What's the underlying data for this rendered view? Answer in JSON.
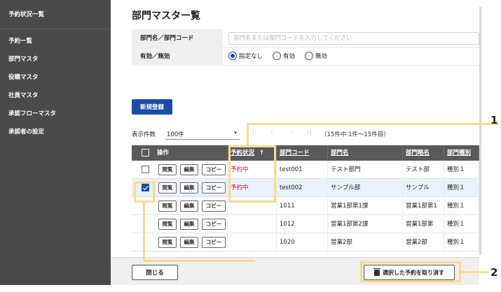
{
  "sidebar": {
    "brand": "予約状況一覧",
    "items": [
      {
        "label": "予約一覧"
      },
      {
        "label": "部門マスタ"
      },
      {
        "label": "役職マスタ"
      },
      {
        "label": "社員マスタ"
      },
      {
        "label": "承認フローマスタ"
      },
      {
        "label": "承認者の設定"
      }
    ]
  },
  "page": {
    "title": "部門マスター覧"
  },
  "filters": {
    "name_label": "部門名／部門コード",
    "name_placeholder": "部門名または部門コードを入力してください",
    "name_value": "",
    "active_label": "有効／無効",
    "radios": [
      {
        "label": "指定なし",
        "checked": true
      },
      {
        "label": "有効",
        "checked": false
      },
      {
        "label": "無効",
        "checked": false
      }
    ]
  },
  "actions": {
    "new_label": "新規登録",
    "close_label": "閉じる",
    "cancel_label": "選択した予約を取り消す"
  },
  "pager": {
    "count_label": "表示件数",
    "count_value": "100件",
    "caret": "▾",
    "first": "|‹",
    "prev": "‹",
    "next": "›",
    "last": "›|",
    "info": "（15件中 1件〜15件目）"
  },
  "table": {
    "headers": {
      "ops": "操作",
      "status": "予約状況",
      "sort_arrow": "↑",
      "code": "部門コード",
      "name": "部門名",
      "short": "部門略名",
      "type": "部門種別"
    },
    "action_buttons": {
      "view": "閲覧",
      "edit": "編集",
      "copy": "コピー"
    },
    "rows": [
      {
        "checkbox": true,
        "checked": false,
        "status": "予約中",
        "code": "test001",
        "name": "テスト部門",
        "short": "テスト部",
        "type": "種別１"
      },
      {
        "checkbox": true,
        "checked": true,
        "status": "予約中",
        "code": "test002",
        "name": "サンプル部",
        "short": "サンプル",
        "type": "種別１"
      },
      {
        "checkbox": false,
        "checked": false,
        "status": "",
        "code": "1011",
        "name": "営業1部第1課",
        "short": "営業1部第1",
        "type": "種別１"
      },
      {
        "checkbox": false,
        "checked": false,
        "status": "",
        "code": "1012",
        "name": "営業1部第2課",
        "short": "営業1部第",
        "type": "種別１"
      },
      {
        "checkbox": false,
        "checked": false,
        "status": "",
        "code": "1020",
        "name": "営業2部",
        "short": "営業2部",
        "type": "種別１"
      }
    ]
  },
  "callouts": [
    {
      "number": "1"
    },
    {
      "number": "2"
    }
  ],
  "colors": {
    "sidebar": "#4a4a4a",
    "primary": "#1a4ca8",
    "table_header": "#595959",
    "status_reserved": "#c8102e",
    "highlight": "#f5dc8c"
  }
}
